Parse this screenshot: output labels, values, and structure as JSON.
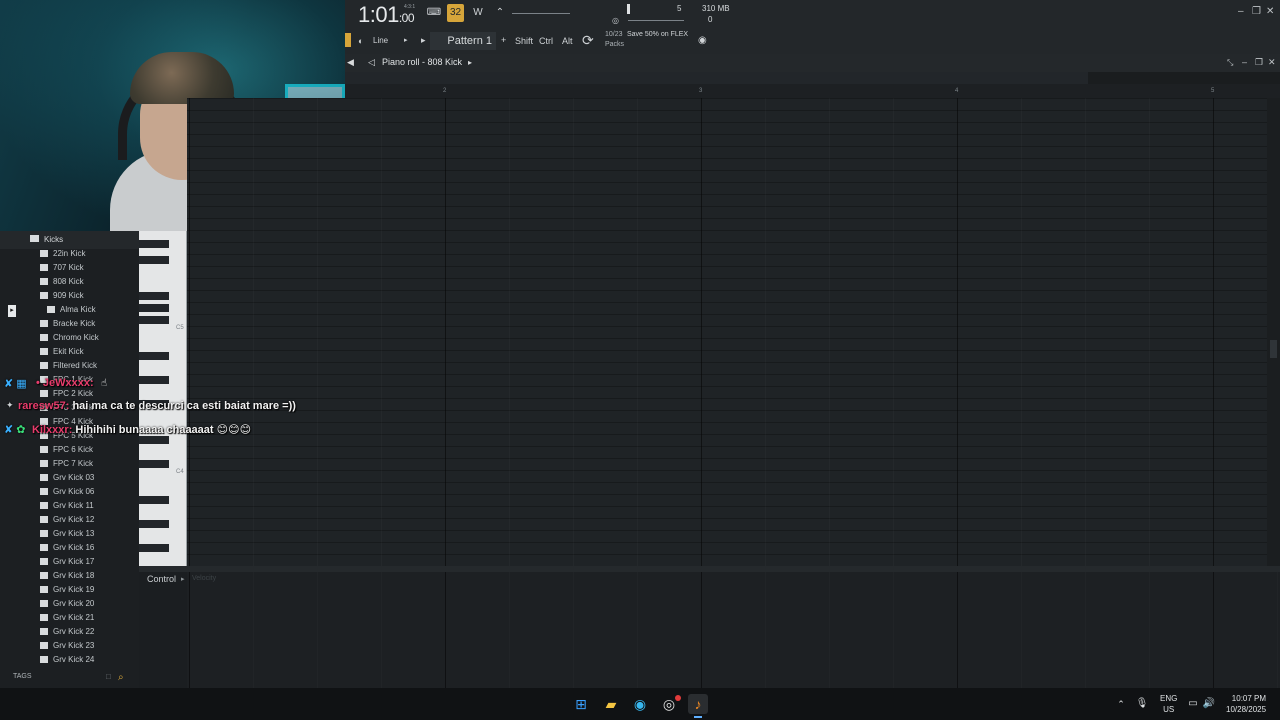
{
  "toolbar": {
    "time_main": "1:01",
    "time_small": ":00",
    "time_sig": "4:3:1",
    "memory": "310 MB",
    "voices": "0",
    "cpu_label": "5",
    "tool_mode": "Line",
    "pattern": "Pattern 1",
    "plus": "+",
    "shift": "Shift",
    "ctrl": "Ctrl",
    "alt": "Alt",
    "news_count": "10/23",
    "news_sub": "Packs",
    "news_text": "Save 50% on FLEX"
  },
  "piano_roll": {
    "title": "Piano roll - 808 Kick",
    "bar_numbers": [
      "2",
      "3",
      "4",
      "5"
    ],
    "key_labels": [
      "C5",
      "C4"
    ],
    "control_label": "Control",
    "control_sub": "Velocity"
  },
  "browser": {
    "folder": "Kicks",
    "items": [
      "22in Kick",
      "707 Kick",
      "808 Kick",
      "909 Kick",
      "Alma Kick",
      "Bracke Kick",
      "Chromo Kick",
      "Ekit Kick",
      "Filtered Kick",
      "FPC 1 Kick",
      "FPC 2 Kick",
      "FPC 3 Kick",
      "FPC 4 Kick",
      "FPC 5 Kick",
      "FPC 6 Kick",
      "FPC 7 Kick",
      "Grv Kick 03",
      "Grv Kick 06",
      "Grv Kick 11",
      "Grv Kick 12",
      "Grv Kick 13",
      "Grv Kick 16",
      "Grv Kick 17",
      "Grv Kick 18",
      "Grv Kick 19",
      "Grv Kick 20",
      "Grv Kick 21",
      "Grv Kick 22",
      "Grv Kick 23",
      "Grv Kick 24"
    ],
    "tags_label": "TAGS"
  },
  "chat": [
    {
      "user": "• JeWxxxx:",
      "text": ""
    },
    {
      "user": "raresw57:",
      "text": "hai ma ca te descurci ca esti baiat mare =))"
    },
    {
      "user": "Kilxxxr:",
      "text": "Hihihihi bunaaaa chaaaaat 😊😊😊"
    }
  ],
  "taskbar": {
    "lang_top": "ENG",
    "lang_bottom": "US",
    "time": "10:07 PM",
    "date": "10/28/2025"
  },
  "colors": {
    "accent": "#d6a53a",
    "chat_user": "#e83c6c",
    "badge": "#3ab0ff"
  }
}
